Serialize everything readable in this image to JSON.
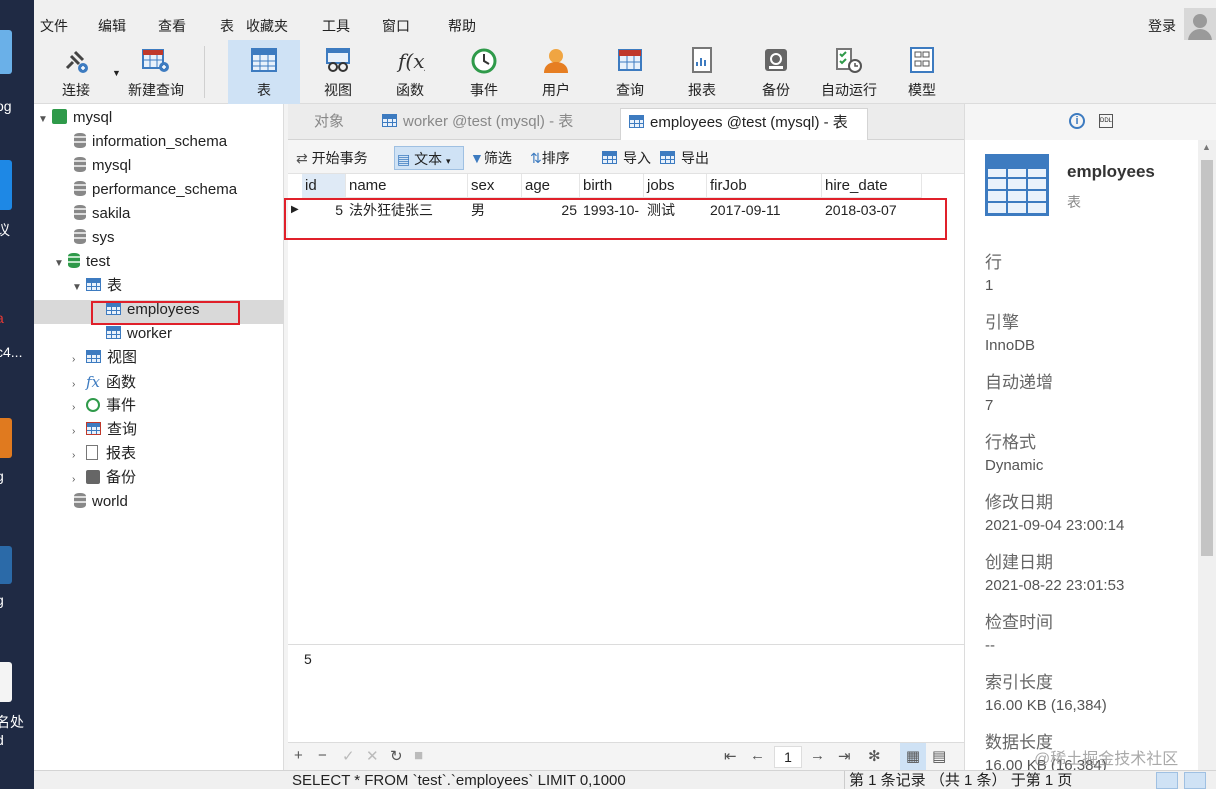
{
  "menu": [
    "文件",
    "编辑",
    "查看",
    "表",
    "收藏夹",
    "工具",
    "窗口",
    "帮助"
  ],
  "login": "登录",
  "toolbar": [
    {
      "label": "连接",
      "icon": "connection-plug-icon"
    },
    {
      "label": "新建查询",
      "icon": "new-query-icon"
    },
    {
      "label": "表",
      "icon": "table-icon",
      "active": true
    },
    {
      "label": "视图",
      "icon": "view-icon"
    },
    {
      "label": "函数",
      "icon": "function-icon"
    },
    {
      "label": "事件",
      "icon": "event-clock-icon"
    },
    {
      "label": "用户",
      "icon": "user-icon"
    },
    {
      "label": "查询",
      "icon": "query-icon"
    },
    {
      "label": "报表",
      "icon": "report-icon"
    },
    {
      "label": "备份",
      "icon": "backup-icon"
    },
    {
      "label": "自动运行",
      "icon": "autorun-icon"
    },
    {
      "label": "模型",
      "icon": "model-icon"
    }
  ],
  "tree": {
    "root": "mysql",
    "dbs": [
      "information_schema",
      "mysql",
      "performance_schema",
      "sakila",
      "sys"
    ],
    "open_db": "test",
    "tables_group": "表",
    "tables": [
      "employees",
      "worker"
    ],
    "groups": [
      "视图",
      "函数",
      "事件",
      "查询",
      "报表",
      "备份"
    ],
    "last_db": "world"
  },
  "tabs": {
    "objects": "对象",
    "worker": "worker @test (mysql) - 表",
    "employees": "employees @test (mysql) - 表"
  },
  "subbar": {
    "begin": "开始事务",
    "text": "文本",
    "filter": "筛选",
    "sort": "排序",
    "import": "导入",
    "export": "导出"
  },
  "grid": {
    "columns": [
      "id",
      "name",
      "sex",
      "age",
      "birth",
      "jobs",
      "firJob",
      "hire_date"
    ],
    "row": [
      "5",
      "法外狂徒张三",
      "男",
      "25",
      "1993-10-",
      "测试",
      "2017-09-11",
      "2018-03-07"
    ]
  },
  "preview_value": "5",
  "page_number": "1",
  "info": {
    "name": "employees",
    "type": "表",
    "props": [
      {
        "k": "行",
        "v": "1"
      },
      {
        "k": "引擎",
        "v": "InnoDB"
      },
      {
        "k": "自动递增",
        "v": "7"
      },
      {
        "k": "行格式",
        "v": "Dynamic"
      },
      {
        "k": "修改日期",
        "v": "2021-09-04 23:00:14"
      },
      {
        "k": "创建日期",
        "v": "2021-08-22 23:01:53"
      },
      {
        "k": "检查时间",
        "v": "--"
      },
      {
        "k": "索引长度",
        "v": "16.00 KB (16,384)"
      },
      {
        "k": "数据长度",
        "v": "16.00 KB (16,384)"
      }
    ]
  },
  "status": {
    "sql": "SELECT * FROM `test`.`employees` LIMIT 0,1000",
    "records": "第 1 条记录 （共 1 条） 于第 1 页"
  },
  "desktop": [
    "og",
    "议",
    "a",
    "c4...",
    "g",
    "g",
    "名处",
    "d"
  ],
  "watermark": "@稀土掘金技术社区",
  "colors": {
    "accent": "#3d7bc0",
    "highlight": "#e0202a",
    "active_tab": "#cfe2f5"
  }
}
